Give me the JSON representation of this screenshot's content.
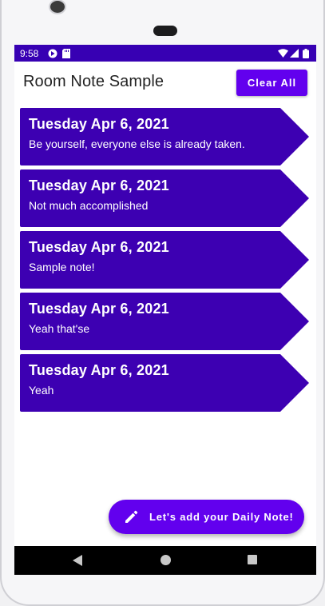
{
  "status_bar": {
    "time": "9:58",
    "background": "#3700b3"
  },
  "app_bar": {
    "title": "Room Note Sample",
    "clear_button_label": "Clear All"
  },
  "notes": [
    {
      "date": "Tuesday Apr 6, 2021",
      "text": "Be yourself, everyone else is already taken."
    },
    {
      "date": "Tuesday Apr 6, 2021",
      "text": "Not much accomplished"
    },
    {
      "date": "Tuesday Apr 6, 2021",
      "text": "Sample note!"
    },
    {
      "date": "Tuesday Apr 6, 2021",
      "text": "Yeah that'se"
    },
    {
      "date": "Tuesday Apr 6, 2021",
      "text": "Yeah"
    }
  ],
  "fab": {
    "label": "Let's add your Daily Note!",
    "icon": "pencil-icon"
  },
  "colors": {
    "primary": "#6200ee",
    "primary_dark": "#3700b3",
    "note_card": "#3d00b2"
  },
  "navigation": {
    "back_icon": "back-triangle-icon",
    "home_icon": "home-circle-icon",
    "recents_icon": "recents-square-icon"
  }
}
